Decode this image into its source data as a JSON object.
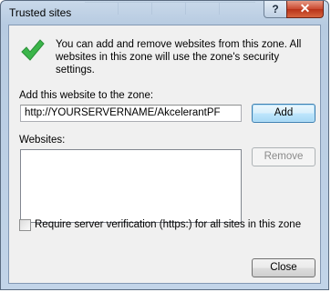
{
  "window": {
    "title": "Trusted sites",
    "help_glyph": "?",
    "close_glyph": "✕"
  },
  "info": {
    "icon": "green-checkmark-icon",
    "text": "You can add and remove websites from this zone. All websites in this zone will use the zone's security settings."
  },
  "add_site": {
    "label": "Add this website to the zone:",
    "value": "http://YOURSERVERNAME/AkcelerantPF",
    "button_label": "Add"
  },
  "websites": {
    "label": "Websites:",
    "items": [],
    "remove_label": "Remove"
  },
  "verification": {
    "label": "Require server verification (https:) for all sites in this zone",
    "checked": false
  },
  "footer": {
    "close_label": "Close"
  },
  "colors": {
    "accent_check": "#3bb54a",
    "close_button": "#c9492f"
  }
}
